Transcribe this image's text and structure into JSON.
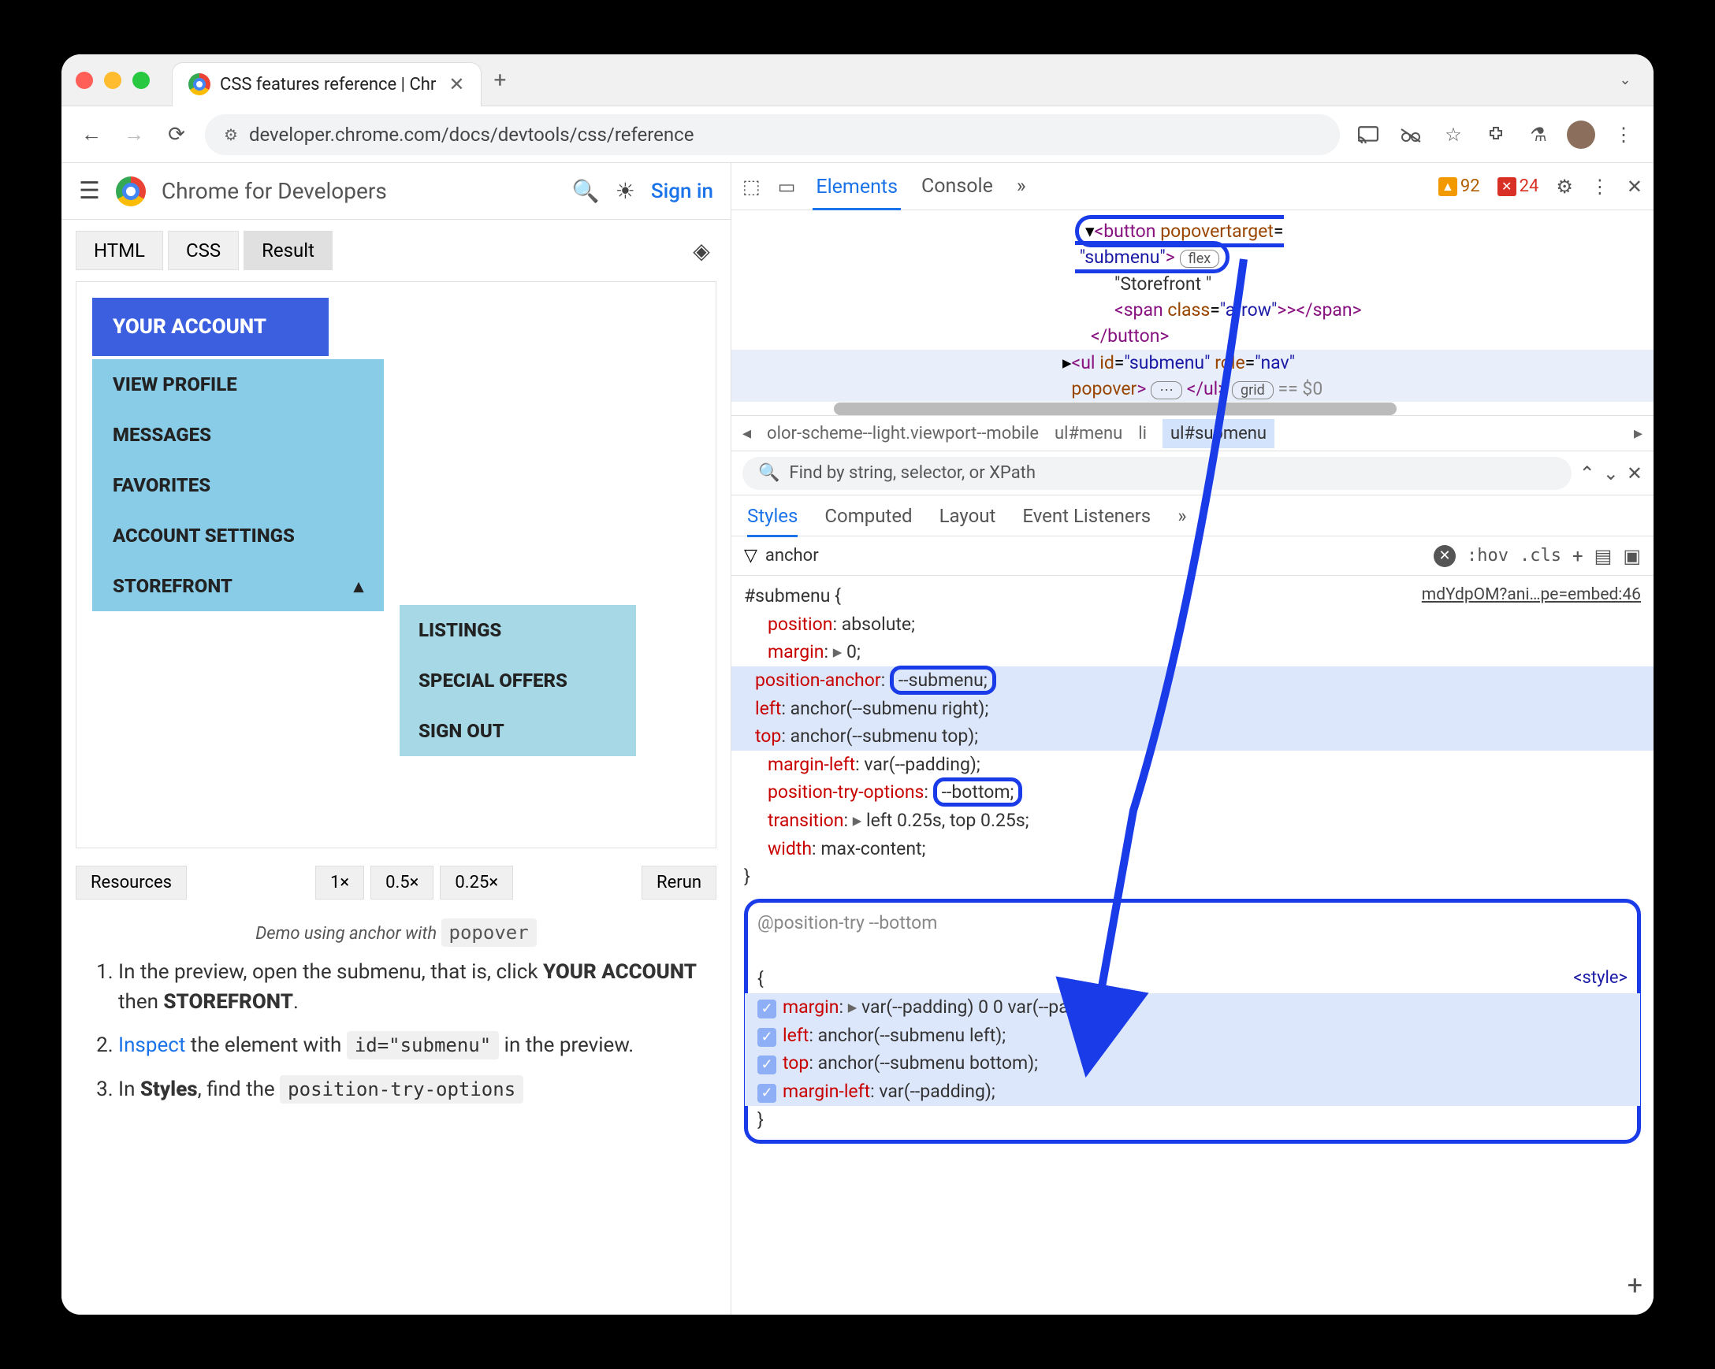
{
  "tab": {
    "title": "CSS features reference  |  Chr"
  },
  "url": "developer.chrome.com/docs/devtools/css/reference",
  "siteHeader": {
    "brand": "Chrome for Developers",
    "signin": "Sign in"
  },
  "codeTabs": {
    "html": "HTML",
    "css": "CSS",
    "result": "Result"
  },
  "preview": {
    "yourAccount": "YOUR ACCOUNT",
    "items": [
      "VIEW PROFILE",
      "MESSAGES",
      "FAVORITES",
      "ACCOUNT SETTINGS",
      "STOREFRONT"
    ],
    "arrow": "▴",
    "sub": [
      "LISTINGS",
      "SPECIAL OFFERS",
      "SIGN OUT"
    ]
  },
  "resources": {
    "label": "Resources",
    "zoom": [
      "1×",
      "0.5×",
      "0.25×"
    ],
    "rerun": "Rerun"
  },
  "caption": {
    "pre": "Demo using anchor with ",
    "code": "popover"
  },
  "steps": {
    "s1a": "In the preview, open the submenu, that is, click ",
    "s1b": "YOUR ACCOUNT",
    "s1c": " then ",
    "s1d": "STOREFRONT",
    "s1e": ".",
    "s2a": "Inspect",
    "s2b": " the element with ",
    "s2c": "id=\"submenu\"",
    "s2d": " in the preview.",
    "s3a": "In ",
    "s3b": "Styles",
    "s3c": ", find the ",
    "s3d": "position-try-options"
  },
  "devtools": {
    "tabs": {
      "elements": "Elements",
      "console": "Console"
    },
    "more": "»",
    "warnCount": "92",
    "errCount": "24",
    "dom": {
      "l1a": "<button",
      "l1b": " popovertarget",
      "l1c": "=",
      "l2a": "\"submenu\"",
      "l2b": ">",
      "flex": "flex",
      "l3": "\"Storefront \"",
      "l4a": "<span",
      "l4b": " class",
      "l4c": "=",
      "l4d": "\"arrow\"",
      "l4e": ">>",
      "l4f": "</span>",
      "l5": "</button>",
      "l6a": "<ul",
      "l6b": " id",
      "l6c": "=",
      "l6d": "\"submenu\"",
      "l6e": " role",
      "l6f": "=",
      "l6g": "\"nav\"",
      "l7a": "popover",
      "l7b": ">",
      "dots": "⋯",
      "l7c": "</ul>",
      "grid": "grid",
      "l7d": " == $0"
    },
    "crumb": {
      "c1": "olor-scheme--light.viewport--mobile",
      "c2": "ul#menu",
      "c3": "li",
      "c4": "ul#submenu"
    },
    "find": {
      "placeholder": "Find by string, selector, or XPath"
    },
    "stabs": {
      "styles": "Styles",
      "computed": "Computed",
      "layout": "Layout",
      "listeners": "Event Listeners",
      "more": "»"
    },
    "filter": {
      "value": "anchor",
      "hov": ":hov",
      "cls": ".cls"
    },
    "src": "mdYdpOM?ani…pe=embed:46",
    "rule": {
      "sel": "#submenu {",
      "p1n": "position",
      "p1v": ": absolute;",
      "p2n": "margin",
      "p2v": ": ",
      "p2t": "0;",
      "p3n": "position-anchor",
      "p3v": ": ",
      "p3var": "--submenu",
      "p3e": ";",
      "p4n": "left",
      "p4v": ": anchor(",
      "p4var": "--submenu",
      "p4r": " right);",
      "p5n": "top",
      "p5v": ": anchor(",
      "p5var": "--submenu",
      "p5r": " top);",
      "p6n": "margin-left",
      "p6v": ": var(",
      "p6var": "--padding",
      "p6e": ");",
      "p7n": "position-try-options",
      "p7v": ": ",
      "p7var": "--bottom",
      "p7e": ";",
      "p8n": "transition",
      "p8v": ": ",
      "p8t": "left 0.25s, top 0.25s;",
      "p9n": "width",
      "p9v": ": max-content;",
      "close": "}"
    },
    "posTry": {
      "head": "@position-try --bottom",
      "open": "{",
      "style": "<style>",
      "r1n": "margin",
      "r1v": ": ",
      "r1t": "var(",
      "r1var": "--padding",
      "r1m": ") 0 0 var(",
      "r1var2": "--padding",
      "r1e": ");",
      "r2n": "left",
      "r2v": ": anchor(",
      "r2var": "--submenu",
      "r2e": " left);",
      "r3n": "top",
      "r3v": ": anchor(",
      "r3var": "--submenu",
      "r3e": " bottom);",
      "r4n": "margin-left",
      "r4v": ": var(",
      "r4var": "--padding",
      "r4e": ");",
      "close": "}"
    }
  }
}
